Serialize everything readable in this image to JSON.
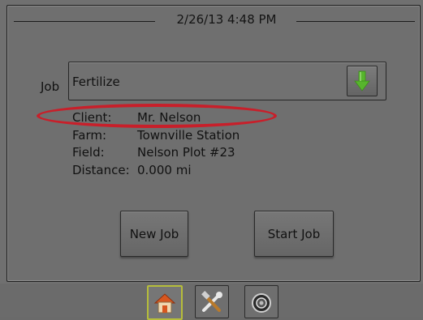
{
  "header": {
    "datetime": "2/26/13 4:48 PM"
  },
  "job": {
    "label": "Job",
    "value": "Fertilize"
  },
  "details": [
    {
      "label": "Client:",
      "value": "Mr. Nelson"
    },
    {
      "label": "Farm:",
      "value": "Townville Station"
    },
    {
      "label": "Field:",
      "value": "Nelson Plot #23"
    },
    {
      "label": "Distance:",
      "value": "0.000 mi"
    }
  ],
  "buttons": {
    "new_job": "New Job",
    "start_job": "Start Job"
  },
  "tabs": [
    {
      "icon": "home-icon",
      "selected": true
    },
    {
      "icon": "tools-icon",
      "selected": false
    },
    {
      "icon": "camera-icon",
      "selected": false
    }
  ],
  "colors": {
    "accent_green": "#57b52c",
    "highlight_red": "#c81f2a",
    "tab_selected_border": "#b6bd3a"
  }
}
